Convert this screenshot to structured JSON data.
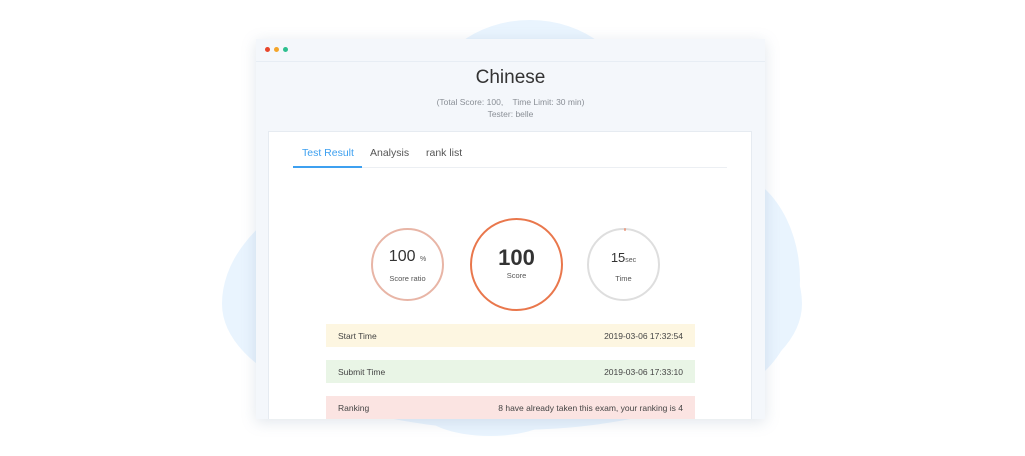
{
  "window": {
    "dots": [
      {
        "name": "close",
        "color": "#e8462b"
      },
      {
        "name": "minimize",
        "color": "#f4a52a"
      },
      {
        "name": "maximize",
        "color": "#2dbf8f"
      }
    ]
  },
  "exam": {
    "title": "Chinese",
    "meta_line": "(Total Score: 100,    Time Limit: 30 min)",
    "tester_line": "Tester: belle"
  },
  "tabs": [
    {
      "label": "Test Result",
      "active": true
    },
    {
      "label": "Analysis",
      "active": false
    },
    {
      "label": "rank list",
      "active": false
    }
  ],
  "stats": {
    "score_ratio": {
      "value": "100",
      "unit": "%",
      "caption": "Score ratio"
    },
    "score": {
      "value": "100",
      "caption": "Score"
    },
    "time": {
      "value": "15",
      "unit": "sec",
      "caption": "Time"
    }
  },
  "info": {
    "start": {
      "label": "Start Time",
      "value": "2019-03-06 17:32:54"
    },
    "submit": {
      "label": "Submit Time",
      "value": "2019-03-06 17:33:10"
    },
    "ranking": {
      "label": "Ranking",
      "value": "8 have already taken this exam, your ranking is 4"
    }
  },
  "colors": {
    "accent": "#3da0f0",
    "score_ring": "#e9774c",
    "ratio_ring": "#e8b5a6",
    "time_ring": "#dedede"
  }
}
